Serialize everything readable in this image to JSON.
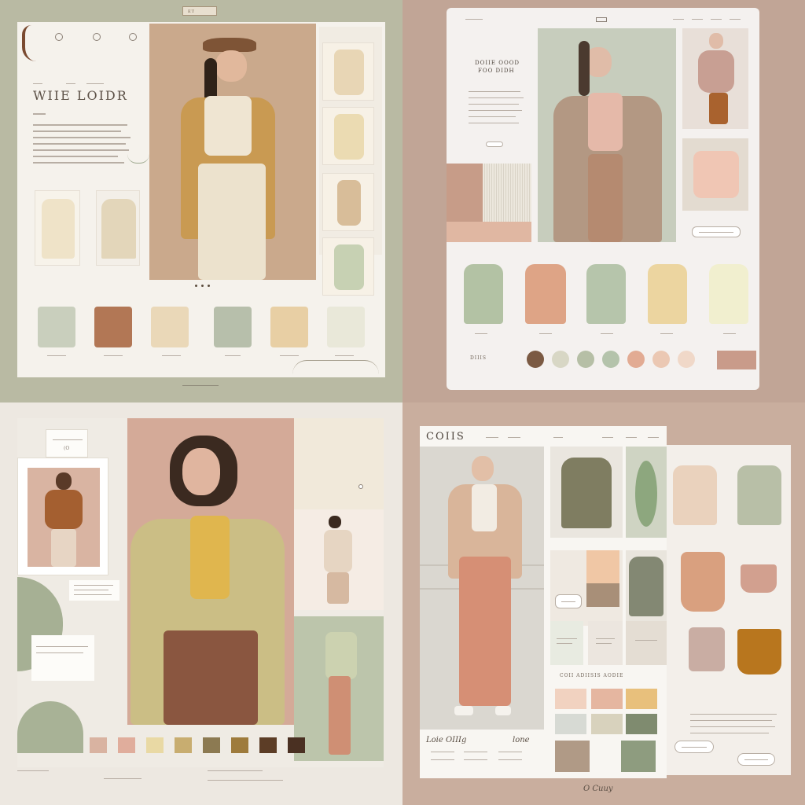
{
  "q1": {
    "brand_title": "WIIE LOIDR",
    "logo_badge": "ET",
    "colors": [
      "#c9cfbd",
      "#b27755",
      "#ead8b8",
      "#b7bfab",
      "#e8cfa4",
      "#e9e8d9"
    ]
  },
  "q2": {
    "heading_line1": "DOIIE OOOD",
    "heading_line2": "FOO DIDH",
    "footer_label": "DIIIS",
    "garment_colors": [
      "#b3c2a4",
      "#dea486",
      "#b6c5ab",
      "#ecd5a0",
      "#f1efcf"
    ],
    "dot_colors": [
      "#7b5a43",
      "#d8d7c5",
      "#b6bfa6",
      "#b4c3ab",
      "#e2ab93",
      "#ebc8b3",
      "#f0d8c8"
    ]
  },
  "q3": {
    "caption": "(O",
    "colors": [
      "#d9b3a1",
      "#e0ad9c",
      "#e9d9a4",
      "#c8ad70",
      "#8c7a52",
      "#9e7b3c",
      "#5c3d26",
      "#4a3022"
    ]
  },
  "q4": {
    "brand_title": "COIIS",
    "bottom_title": "Loie OIIIg",
    "bottom_subtitle": "lone",
    "section_label": "COII ADIISIS AODIE",
    "signature": "O Cuuy",
    "palette_colors": [
      "#f1d2c0",
      "#e5b6a0",
      "#e8c07c",
      "#d7dad4",
      "#d8d2bd",
      "#7f8b6f"
    ],
    "big_colors": [
      "#b09a86",
      "#8e9c7f"
    ]
  }
}
